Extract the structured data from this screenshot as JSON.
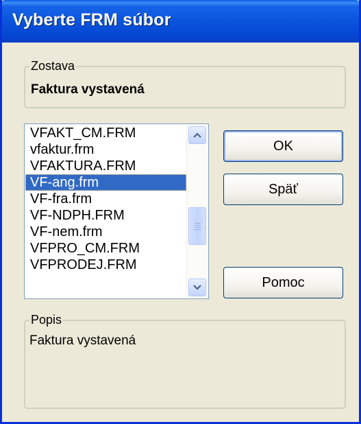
{
  "window": {
    "title": "Vyberte FRM súbor"
  },
  "zostava": {
    "label": "Zostava",
    "value": "Faktura vystavená"
  },
  "file_list": {
    "items": [
      "VFAKT_CM.FRM",
      "vfaktur.frm",
      "VFAKTURA.FRM",
      "VF-ang.frm",
      "VF-fra.frm",
      "VF-NDPH.FRM",
      "VF-nem.frm",
      "VFPRO_CM.FRM",
      "VFPRODEJ.FRM"
    ],
    "selected": "VF-ang.frm"
  },
  "buttons": {
    "ok": "OK",
    "back": "Späť",
    "help": "Pomoc"
  },
  "popis": {
    "label": "Popis",
    "value": "Faktura vystavená"
  },
  "colors": {
    "titlebar": "#0a54dc",
    "selection": "#316ac5",
    "dialog_bg": "#ece9d8"
  }
}
